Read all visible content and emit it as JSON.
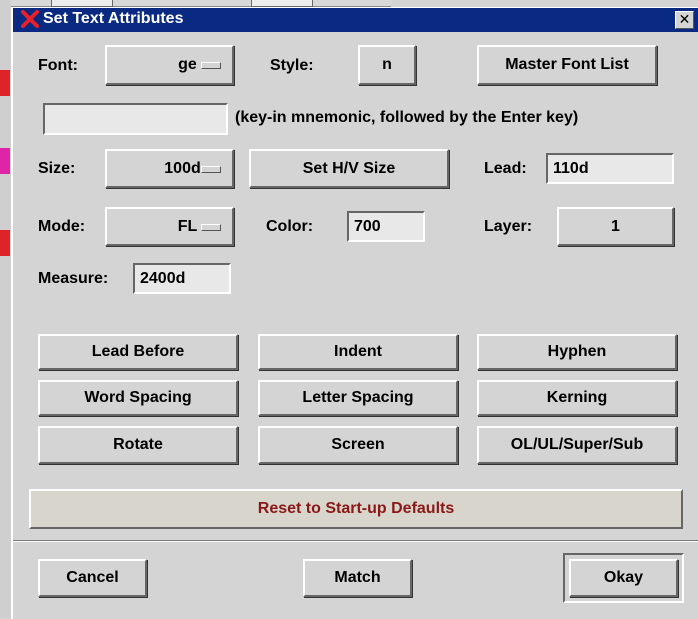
{
  "window": {
    "title": "Set Text Attributes",
    "close_glyph": "✕"
  },
  "font": {
    "label": "Font:",
    "value": "ge"
  },
  "style": {
    "label": "Style:",
    "value": "n"
  },
  "master_font_list_label": "Master Font List",
  "mnemonic": {
    "value": "",
    "hint": "(key-in mnemonic, followed by the Enter key)"
  },
  "size": {
    "label": "Size:",
    "value": "100d"
  },
  "set_hv_size_label": "Set H/V Size",
  "lead": {
    "label": "Lead:",
    "value": "110d"
  },
  "mode": {
    "label": "Mode:",
    "value": "FL"
  },
  "color": {
    "label": "Color:",
    "value": "700"
  },
  "layer": {
    "label": "Layer:",
    "value": "1"
  },
  "measure": {
    "label": "Measure:",
    "value": "2400d"
  },
  "buttons": {
    "lead_before": "Lead Before",
    "indent": "Indent",
    "hyphen": "Hyphen",
    "word_spacing": "Word Spacing",
    "letter_spacing": "Letter Spacing",
    "kerning": "Kerning",
    "rotate": "Rotate",
    "screen": "Screen",
    "ol_ul_super_sub": "OL/UL/Super/Sub"
  },
  "reset_label": "Reset to Start-up Defaults",
  "footer": {
    "cancel": "Cancel",
    "match": "Match",
    "okay": "Okay"
  },
  "colors": {
    "titlebar": "#0a2a82",
    "reset_text": "#8a1818",
    "dialog_bg": "#d4d4d4"
  }
}
